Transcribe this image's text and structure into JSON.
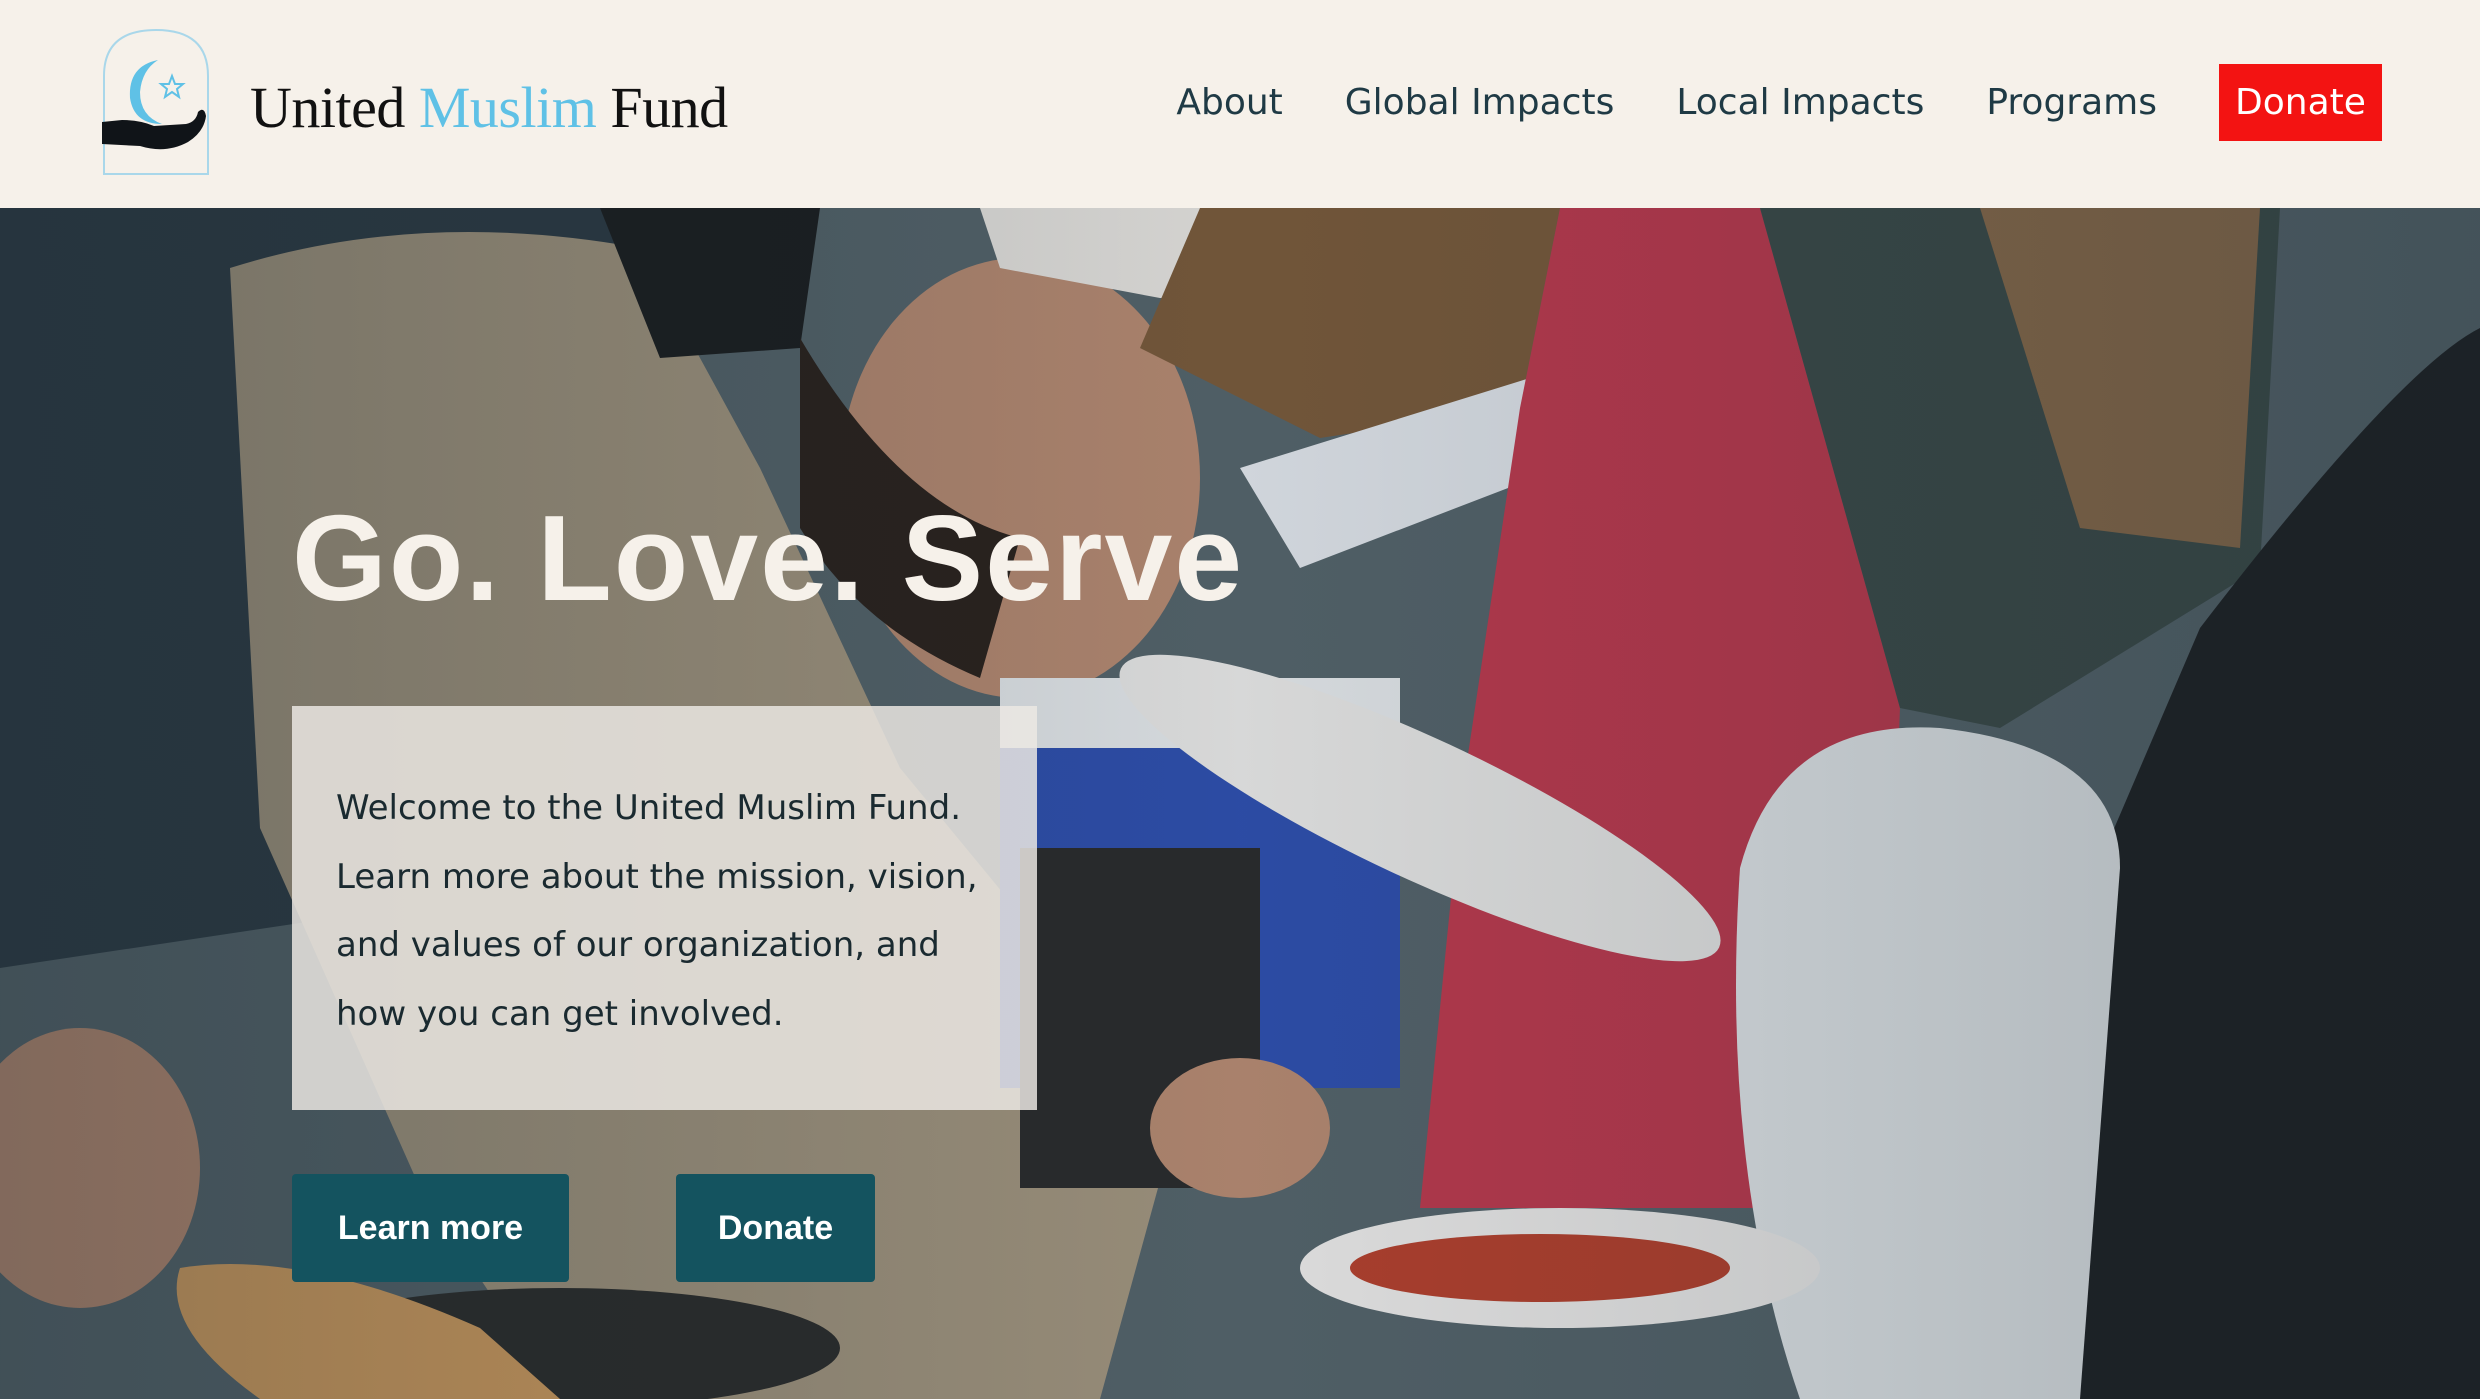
{
  "header": {
    "logo": {
      "icon": "hand-crescent-star-logo-icon",
      "name_part1": "United",
      "name_part2": "Muslim",
      "name_part3": "Fund"
    },
    "nav": {
      "items": [
        {
          "label": "About"
        },
        {
          "label": "Global Impacts"
        },
        {
          "label": "Local Impacts"
        },
        {
          "label": "Programs"
        }
      ],
      "donate_label": "Donate"
    }
  },
  "hero": {
    "title": "Go. Love. Serve",
    "intro": "Welcome to the United Muslim Fund. Learn more about the mission, vision, and values of our organization, and how you can get involved.",
    "buttons": {
      "learn_more": "Learn more",
      "donate": "Donate"
    }
  },
  "colors": {
    "background": "#f6f1ea",
    "accent_blue": "#5fc1e6",
    "donate_red": "#f31312",
    "button_teal": "#14535f",
    "nav_text": "#1f3a45"
  }
}
